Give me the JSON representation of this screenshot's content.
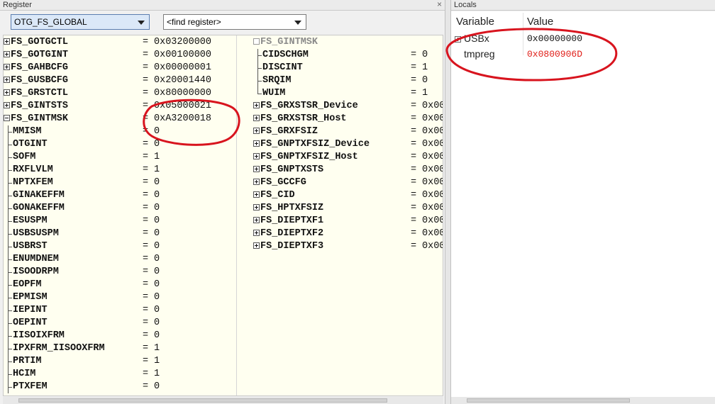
{
  "register_panel": {
    "title": "Register",
    "group_select": "OTG_FS_GLOBAL",
    "find_placeholder": "<find register>",
    "left_column": [
      {
        "name": "FS_GOTGCTL",
        "value": "0x03200000",
        "node": "plus"
      },
      {
        "name": "FS_GOTGINT",
        "value": "0x00100000",
        "node": "plus"
      },
      {
        "name": "FS_GAHBCFG",
        "value": "0x00000001",
        "node": "plus"
      },
      {
        "name": "FS_GUSBCFG",
        "value": "0x20001440",
        "node": "plus"
      },
      {
        "name": "FS_GRSTCTL",
        "value": "0x80000000",
        "node": "plus"
      },
      {
        "name": "FS_GINTSTS",
        "value": "0x05000021",
        "node": "plus"
      },
      {
        "name": "FS_GINTMSK",
        "value": "0xA3200018",
        "node": "minus"
      },
      {
        "name": "MMISM",
        "value": "0",
        "node": "child"
      },
      {
        "name": "OTGINT",
        "value": "0",
        "node": "child"
      },
      {
        "name": "SOFM",
        "value": "1",
        "node": "child"
      },
      {
        "name": "RXFLVLM",
        "value": "1",
        "node": "child"
      },
      {
        "name": "NPTXFEM",
        "value": "0",
        "node": "child"
      },
      {
        "name": "GINAKEFFM",
        "value": "0",
        "node": "child"
      },
      {
        "name": "GONAKEFFM",
        "value": "0",
        "node": "child"
      },
      {
        "name": "ESUSPM",
        "value": "0",
        "node": "child"
      },
      {
        "name": "USBSUSPM",
        "value": "0",
        "node": "child"
      },
      {
        "name": "USBRST",
        "value": "0",
        "node": "child"
      },
      {
        "name": "ENUMDNEM",
        "value": "0",
        "node": "child"
      },
      {
        "name": "ISOODRPM",
        "value": "0",
        "node": "child"
      },
      {
        "name": "EOPFM",
        "value": "0",
        "node": "child"
      },
      {
        "name": "EPMISM",
        "value": "0",
        "node": "child"
      },
      {
        "name": "IEPINT",
        "value": "0",
        "node": "child"
      },
      {
        "name": "OEPINT",
        "value": "0",
        "node": "child"
      },
      {
        "name": "IISOIXFRM",
        "value": "0",
        "node": "child"
      },
      {
        "name": "IPXFRM_IISOOXFRM",
        "value": "1",
        "node": "child"
      },
      {
        "name": "PRTIM",
        "value": "1",
        "node": "child"
      },
      {
        "name": "HCIM",
        "value": "1",
        "node": "child"
      },
      {
        "name": "PTXFEM",
        "value": "0",
        "node": "child"
      }
    ],
    "right_column": [
      {
        "name": "FS_GINTMSK",
        "value": "",
        "node": "empty"
      },
      {
        "name": "CIDSCHGM",
        "value": "0",
        "node": "child"
      },
      {
        "name": "DISCINT",
        "value": "1",
        "node": "child"
      },
      {
        "name": "SRQIM",
        "value": "0",
        "node": "child"
      },
      {
        "name": "WUIM",
        "value": "1",
        "node": "child-last"
      },
      {
        "name": "FS_GRXSTSR_Device",
        "value": "0x00",
        "node": "plus"
      },
      {
        "name": "FS_GRXSTSR_Host",
        "value": "0x00",
        "node": "plus"
      },
      {
        "name": "FS_GRXFSIZ",
        "value": "0x00",
        "node": "plus"
      },
      {
        "name": "FS_GNPTXFSIZ_Device",
        "value": "0x00",
        "node": "plus"
      },
      {
        "name": "FS_GNPTXFSIZ_Host",
        "value": "0x00",
        "node": "plus"
      },
      {
        "name": "FS_GNPTXSTS",
        "value": "0x00",
        "node": "plus"
      },
      {
        "name": "FS_GCCFG",
        "value": "0x00",
        "node": "plus"
      },
      {
        "name": "FS_CID",
        "value": "0x00",
        "node": "plus"
      },
      {
        "name": "FS_HPTXFSIZ",
        "value": "0x00",
        "node": "plus"
      },
      {
        "name": "FS_DIEPTXF1",
        "value": "0x00",
        "node": "plus"
      },
      {
        "name": "FS_DIEPTXF2",
        "value": "0x00",
        "node": "plus"
      },
      {
        "name": "FS_DIEPTXF3",
        "value": "0x00",
        "node": "plus"
      }
    ]
  },
  "locals_panel": {
    "title": "Locals",
    "col_variable": "Variable",
    "col_value": "Value",
    "rows": [
      {
        "variable": "USBx",
        "value": "0x00000000",
        "expandable": true,
        "value_color": "#111111"
      },
      {
        "variable": "tmpreg",
        "value": "0x0800906D",
        "expandable": false,
        "value_color": "#e0201a"
      }
    ]
  },
  "annotation_color": "#d8141e"
}
